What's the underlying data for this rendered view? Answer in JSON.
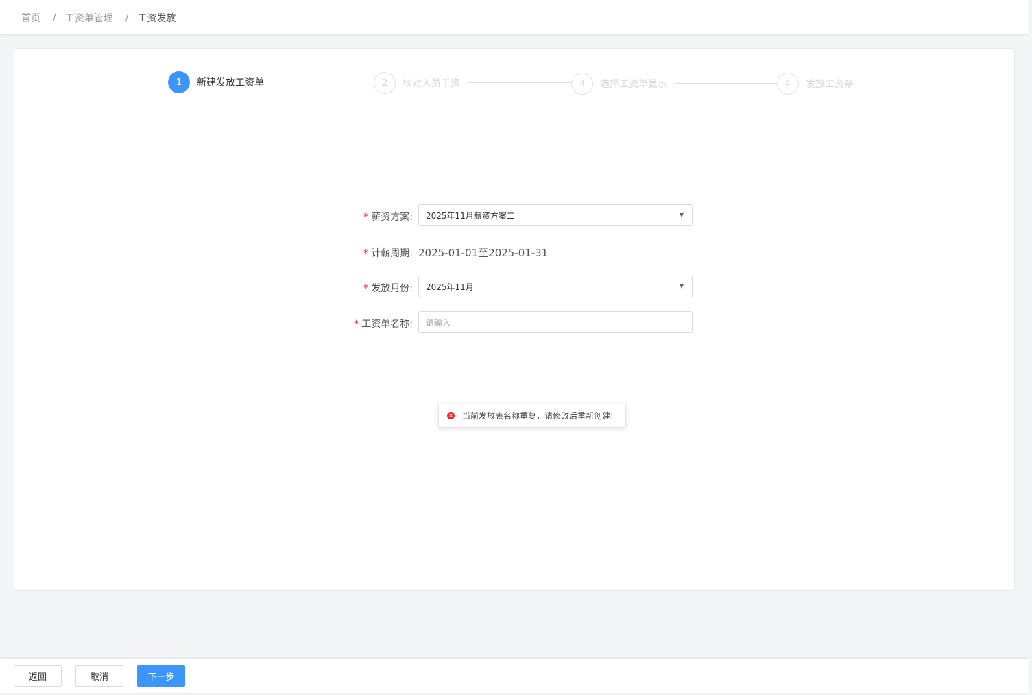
{
  "breadcrumb": {
    "home": "首页",
    "payroll_mgmt": "工资单管理",
    "current": "工资发放",
    "separator": "/"
  },
  "steps": [
    {
      "number": "1",
      "label": "新建发放工资单",
      "state": "active"
    },
    {
      "number": "2",
      "label": "核对人员工资",
      "state": "pending"
    },
    {
      "number": "3",
      "label": "选择工资单显示",
      "state": "pending"
    },
    {
      "number": "4",
      "label": "发放工资条",
      "state": "pending"
    }
  ],
  "form": {
    "required_mark": "*",
    "salary_plan": {
      "label": "薪资方案:",
      "value": "2025年11月薪资方案二"
    },
    "pay_period": {
      "label": "计薪周期:",
      "value": "2025-01-01至2025-01-31"
    },
    "pay_month": {
      "label": "发放月份:",
      "value": "2025年11月"
    },
    "payroll_name": {
      "label": "工资单名称:",
      "placeholder": "请输入",
      "value": ""
    }
  },
  "toast": {
    "type": "error",
    "message": "当前发放表名称重复，请修改后重新创建!",
    "icon": "error-circle-icon"
  },
  "footer": {
    "back_label": "返回",
    "cancel_label": "取消",
    "next_label": "下一步"
  },
  "colors": {
    "primary": "#3b95fb",
    "error": "#f5222d",
    "required": "#f5222d"
  }
}
